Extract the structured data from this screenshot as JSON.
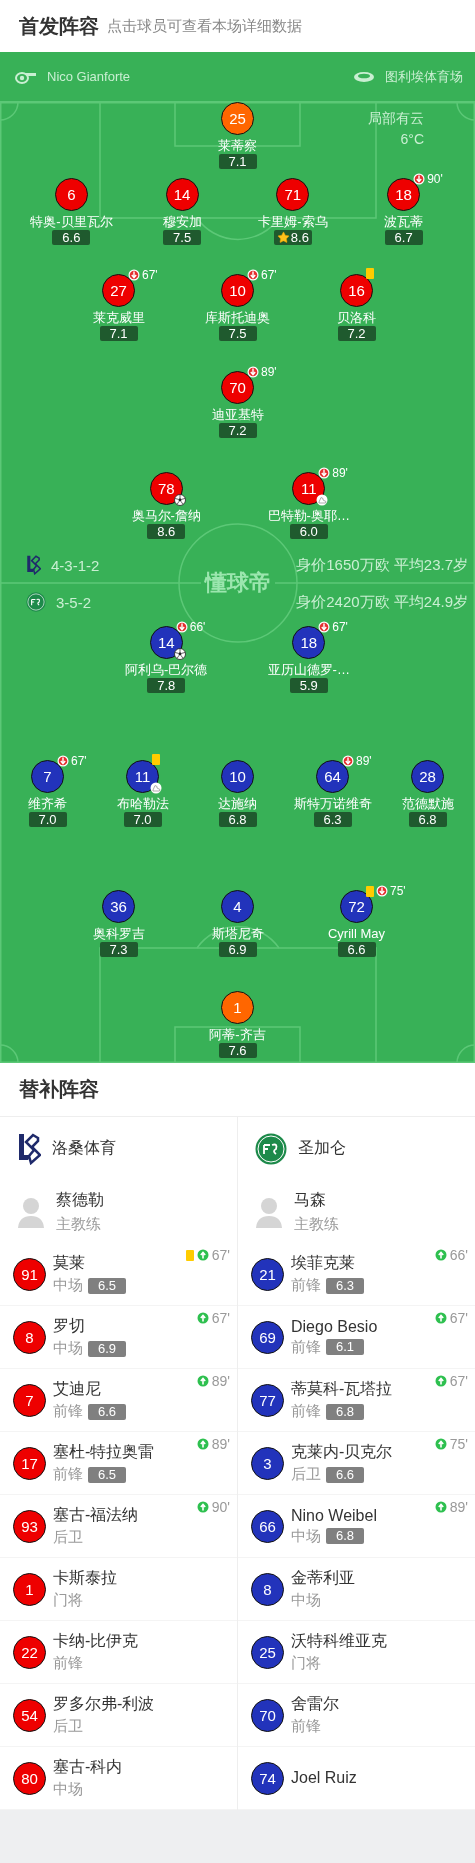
{
  "header": {
    "title": "首发阵容",
    "hint": "点击球员可查看本场详细数据"
  },
  "match_info": {
    "referee": "Nico Gianforte",
    "stadium": "图利埃体育场",
    "weather": "局部有云",
    "temperature": "6°C"
  },
  "pitch_logo": "懂球帝",
  "home": {
    "formation": "4-3-1-2",
    "value_age": "身价1650万欧 平均23.7岁",
    "lines": [
      {
        "players": [
          {
            "number": "25",
            "name": "莱蒂察",
            "rating": "7.1",
            "color": "#ff6600",
            "best": false,
            "yellow_card": false,
            "goal": false,
            "assist": false
          }
        ]
      },
      {
        "players": [
          {
            "number": "6",
            "name": "特奥-贝里瓦尔",
            "rating": "6.6",
            "color": "#ee0000",
            "best": false,
            "yellow_card": false,
            "goal": false,
            "assist": false
          },
          {
            "number": "14",
            "name": "穆安加",
            "rating": "7.5",
            "color": "#ee0000",
            "best": false,
            "yellow_card": false,
            "goal": false,
            "assist": false
          },
          {
            "number": "71",
            "name": "卡里姆-索乌",
            "rating": "8.6",
            "color": "#ee0000",
            "best": true,
            "yellow_card": false,
            "goal": false,
            "assist": false
          },
          {
            "number": "18",
            "name": "波瓦蒂",
            "rating": "6.7",
            "color": "#ee0000",
            "best": false,
            "yellow_card": false,
            "goal": false,
            "assist": false,
            "sub_off": "90'"
          }
        ]
      },
      {
        "players": [
          {
            "number": "27",
            "name": "莱克威里",
            "rating": "7.1",
            "color": "#ee0000",
            "best": false,
            "yellow_card": false,
            "goal": false,
            "assist": false,
            "sub_off": "67'"
          },
          {
            "number": "10",
            "name": "库斯托迪奥",
            "rating": "7.5",
            "color": "#ee0000",
            "best": false,
            "yellow_card": false,
            "goal": false,
            "assist": false,
            "sub_off": "67'"
          },
          {
            "number": "16",
            "name": "贝洛科",
            "rating": "7.2",
            "color": "#ee0000",
            "best": false,
            "yellow_card": true,
            "goal": false,
            "assist": false
          }
        ]
      },
      {
        "players": [
          {
            "number": "70",
            "name": "迪亚基特",
            "rating": "7.2",
            "color": "#ee0000",
            "best": false,
            "yellow_card": false,
            "goal": false,
            "assist": false,
            "sub_off": "89'"
          }
        ]
      },
      {
        "players": [
          {
            "number": "78",
            "name": "奥马尔-詹纳",
            "rating": "8.6",
            "color": "#ee0000",
            "best": false,
            "yellow_card": false,
            "goal": true,
            "assist": false
          },
          {
            "number": "11",
            "name": "巴特勒-奥耶…",
            "rating": "6.0",
            "color": "#ee0000",
            "best": false,
            "yellow_card": false,
            "goal": false,
            "assist": true,
            "sub_off": "89'"
          }
        ]
      }
    ]
  },
  "away": {
    "formation": "3-5-2",
    "value_age": "身价2420万欧 平均24.9岁",
    "lines": [
      {
        "players": [
          {
            "number": "14",
            "name": "阿利乌-巴尔德",
            "rating": "7.8",
            "color": "#2233bb",
            "best": false,
            "yellow_card": false,
            "goal": true,
            "assist": false,
            "sub_off": "66'"
          },
          {
            "number": "18",
            "name": "亚历山德罗-…",
            "rating": "5.9",
            "color": "#2233bb",
            "best": false,
            "yellow_card": false,
            "goal": false,
            "assist": false,
            "sub_off": "67'"
          }
        ]
      },
      {
        "players": [
          {
            "number": "7",
            "name": "维齐希",
            "rating": "7.0",
            "color": "#2233bb",
            "best": false,
            "yellow_card": false,
            "goal": false,
            "assist": false,
            "sub_off": "67'"
          },
          {
            "number": "11",
            "name": "布哈勒法",
            "rating": "7.0",
            "color": "#2233bb",
            "best": false,
            "yellow_card": true,
            "goal": false,
            "assist": true
          },
          {
            "number": "10",
            "name": "达施纳",
            "rating": "6.8",
            "color": "#2233bb",
            "best": false,
            "yellow_card": false,
            "goal": false,
            "assist": false
          },
          {
            "number": "64",
            "name": "斯特万诺维奇",
            "rating": "6.3",
            "color": "#2233bb",
            "best": false,
            "yellow_card": false,
            "goal": false,
            "assist": false,
            "sub_off": "89'"
          },
          {
            "number": "28",
            "name": "范德默施",
            "rating": "6.8",
            "color": "#2233bb",
            "best": false,
            "yellow_card": false,
            "goal": false,
            "assist": false
          }
        ]
      },
      {
        "players": [
          {
            "number": "36",
            "name": "奥科罗吉",
            "rating": "7.3",
            "color": "#2233bb",
            "best": false,
            "yellow_card": false,
            "goal": false,
            "assist": false
          },
          {
            "number": "4",
            "name": "斯塔尼奇",
            "rating": "6.9",
            "color": "#2233bb",
            "best": false,
            "yellow_card": false,
            "goal": false,
            "assist": false
          },
          {
            "number": "72",
            "name": "Cyrill May",
            "rating": "6.6",
            "color": "#2233bb",
            "best": false,
            "yellow_card": true,
            "goal": false,
            "assist": false,
            "sub_off": "75'"
          }
        ]
      },
      {
        "players": [
          {
            "number": "1",
            "name": "阿蒂-齐吉",
            "rating": "7.6",
            "color": "#ff6600",
            "best": false,
            "yellow_card": false,
            "goal": false,
            "assist": false
          }
        ]
      }
    ]
  },
  "substitutes": {
    "title": "替补阵容",
    "teams": [
      {
        "name": "洛桑体育",
        "kind": "lausanne",
        "color": "#ee0000",
        "coach": {
          "name": "蔡德勒",
          "role": "主教练"
        },
        "players": [
          {
            "number": "91",
            "name": "莫莱",
            "position": "中场",
            "rating": "6.5",
            "yellow_card": true,
            "sub_in": "67'"
          },
          {
            "number": "8",
            "name": "罗切",
            "position": "中场",
            "rating": "6.9",
            "yellow_card": false,
            "sub_in": "67'"
          },
          {
            "number": "7",
            "name": "艾迪尼",
            "position": "前锋",
            "rating": "6.6",
            "yellow_card": false,
            "sub_in": "89'"
          },
          {
            "number": "17",
            "name": "塞杜-特拉奥雷",
            "position": "前锋",
            "rating": "6.5",
            "yellow_card": false,
            "sub_in": "89'"
          },
          {
            "number": "93",
            "name": "塞古-福法纳",
            "position": "后卫",
            "yellow_card": false,
            "sub_in": "90'"
          },
          {
            "number": "1",
            "name": "卡斯泰拉",
            "position": "门将",
            "yellow_card": false
          },
          {
            "number": "22",
            "name": "卡纳-比伊克",
            "position": "前锋",
            "yellow_card": false
          },
          {
            "number": "54",
            "name": "罗多尔弗-利波",
            "position": "后卫",
            "yellow_card": false
          },
          {
            "number": "80",
            "name": "塞古-科内",
            "position": "中场",
            "yellow_card": false
          }
        ]
      },
      {
        "name": "圣加仑",
        "kind": "stgallen",
        "color": "#2233bb",
        "coach": {
          "name": "马森",
          "role": "主教练"
        },
        "players": [
          {
            "number": "21",
            "name": "埃菲克莱",
            "position": "前锋",
            "rating": "6.3",
            "yellow_card": false,
            "sub_in": "66'"
          },
          {
            "number": "69",
            "name": "Diego Besio",
            "position": "前锋",
            "rating": "6.1",
            "yellow_card": false,
            "sub_in": "67'"
          },
          {
            "number": "77",
            "name": "蒂莫科-瓦塔拉",
            "position": "前锋",
            "rating": "6.8",
            "yellow_card": false,
            "sub_in": "67'"
          },
          {
            "number": "3",
            "name": "克莱内-贝克尔",
            "position": "后卫",
            "rating": "6.6",
            "yellow_card": false,
            "sub_in": "75'"
          },
          {
            "number": "66",
            "name": "Nino Weibel",
            "position": "中场",
            "rating": "6.8",
            "yellow_card": false,
            "sub_in": "89'"
          },
          {
            "number": "8",
            "name": "金蒂利亚",
            "position": "中场",
            "yellow_card": false
          },
          {
            "number": "25",
            "name": "沃特科维亚克",
            "position": "门将",
            "yellow_card": false
          },
          {
            "number": "70",
            "name": "舍雷尔",
            "position": "前锋",
            "yellow_card": false
          },
          {
            "number": "74",
            "name": "Joel Ruiz",
            "yellow_card": false
          }
        ]
      }
    ]
  }
}
